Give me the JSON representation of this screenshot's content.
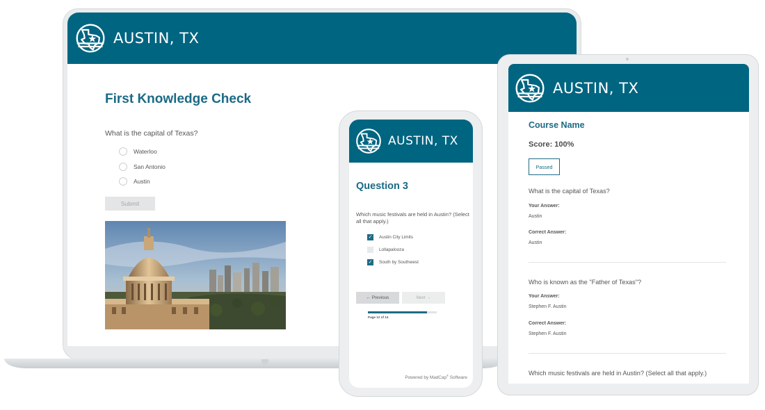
{
  "brand": {
    "name": "AUSTIN, TX",
    "color": "#006581"
  },
  "laptop": {
    "title": "First Knowledge Check",
    "question": "What is the capital of Texas?",
    "options": [
      "Waterloo",
      "San Antonio",
      "Austin"
    ],
    "submit_label": "Submit"
  },
  "phone": {
    "title": "Question 3",
    "question": "Which music festivals are held in Austin? (Select all that apply.)",
    "options": [
      {
        "label": "Austin City Limits",
        "checked": true
      },
      {
        "label": "Lollapalooza",
        "checked": false
      },
      {
        "label": "South by Southwest",
        "checked": true
      }
    ],
    "previous_label": "← Previous",
    "next_label": "Next →",
    "page_label": "Page 12 of 14",
    "progress": 0.857,
    "powered_by": "Powered by MadCap",
    "powered_by_suffix": "Software",
    "registered_mark": "®"
  },
  "tablet": {
    "course_name": "Course Name",
    "score": "Score: 100%",
    "status_badge": "Passed",
    "your_answer_label": "Your Answer:",
    "correct_answer_label": "Correct Answer:",
    "results": [
      {
        "question": "What is the capital of Texas?",
        "your_answer": "Austin",
        "correct_answer": "Austin"
      },
      {
        "question": "Who is known as the \"Father of Texas\"?",
        "your_answer": "Stephen F. Austin",
        "correct_answer": "Stephen F. Austin"
      },
      {
        "question": "Which music festivals are held in Austin? (Select all that apply.)"
      }
    ]
  }
}
